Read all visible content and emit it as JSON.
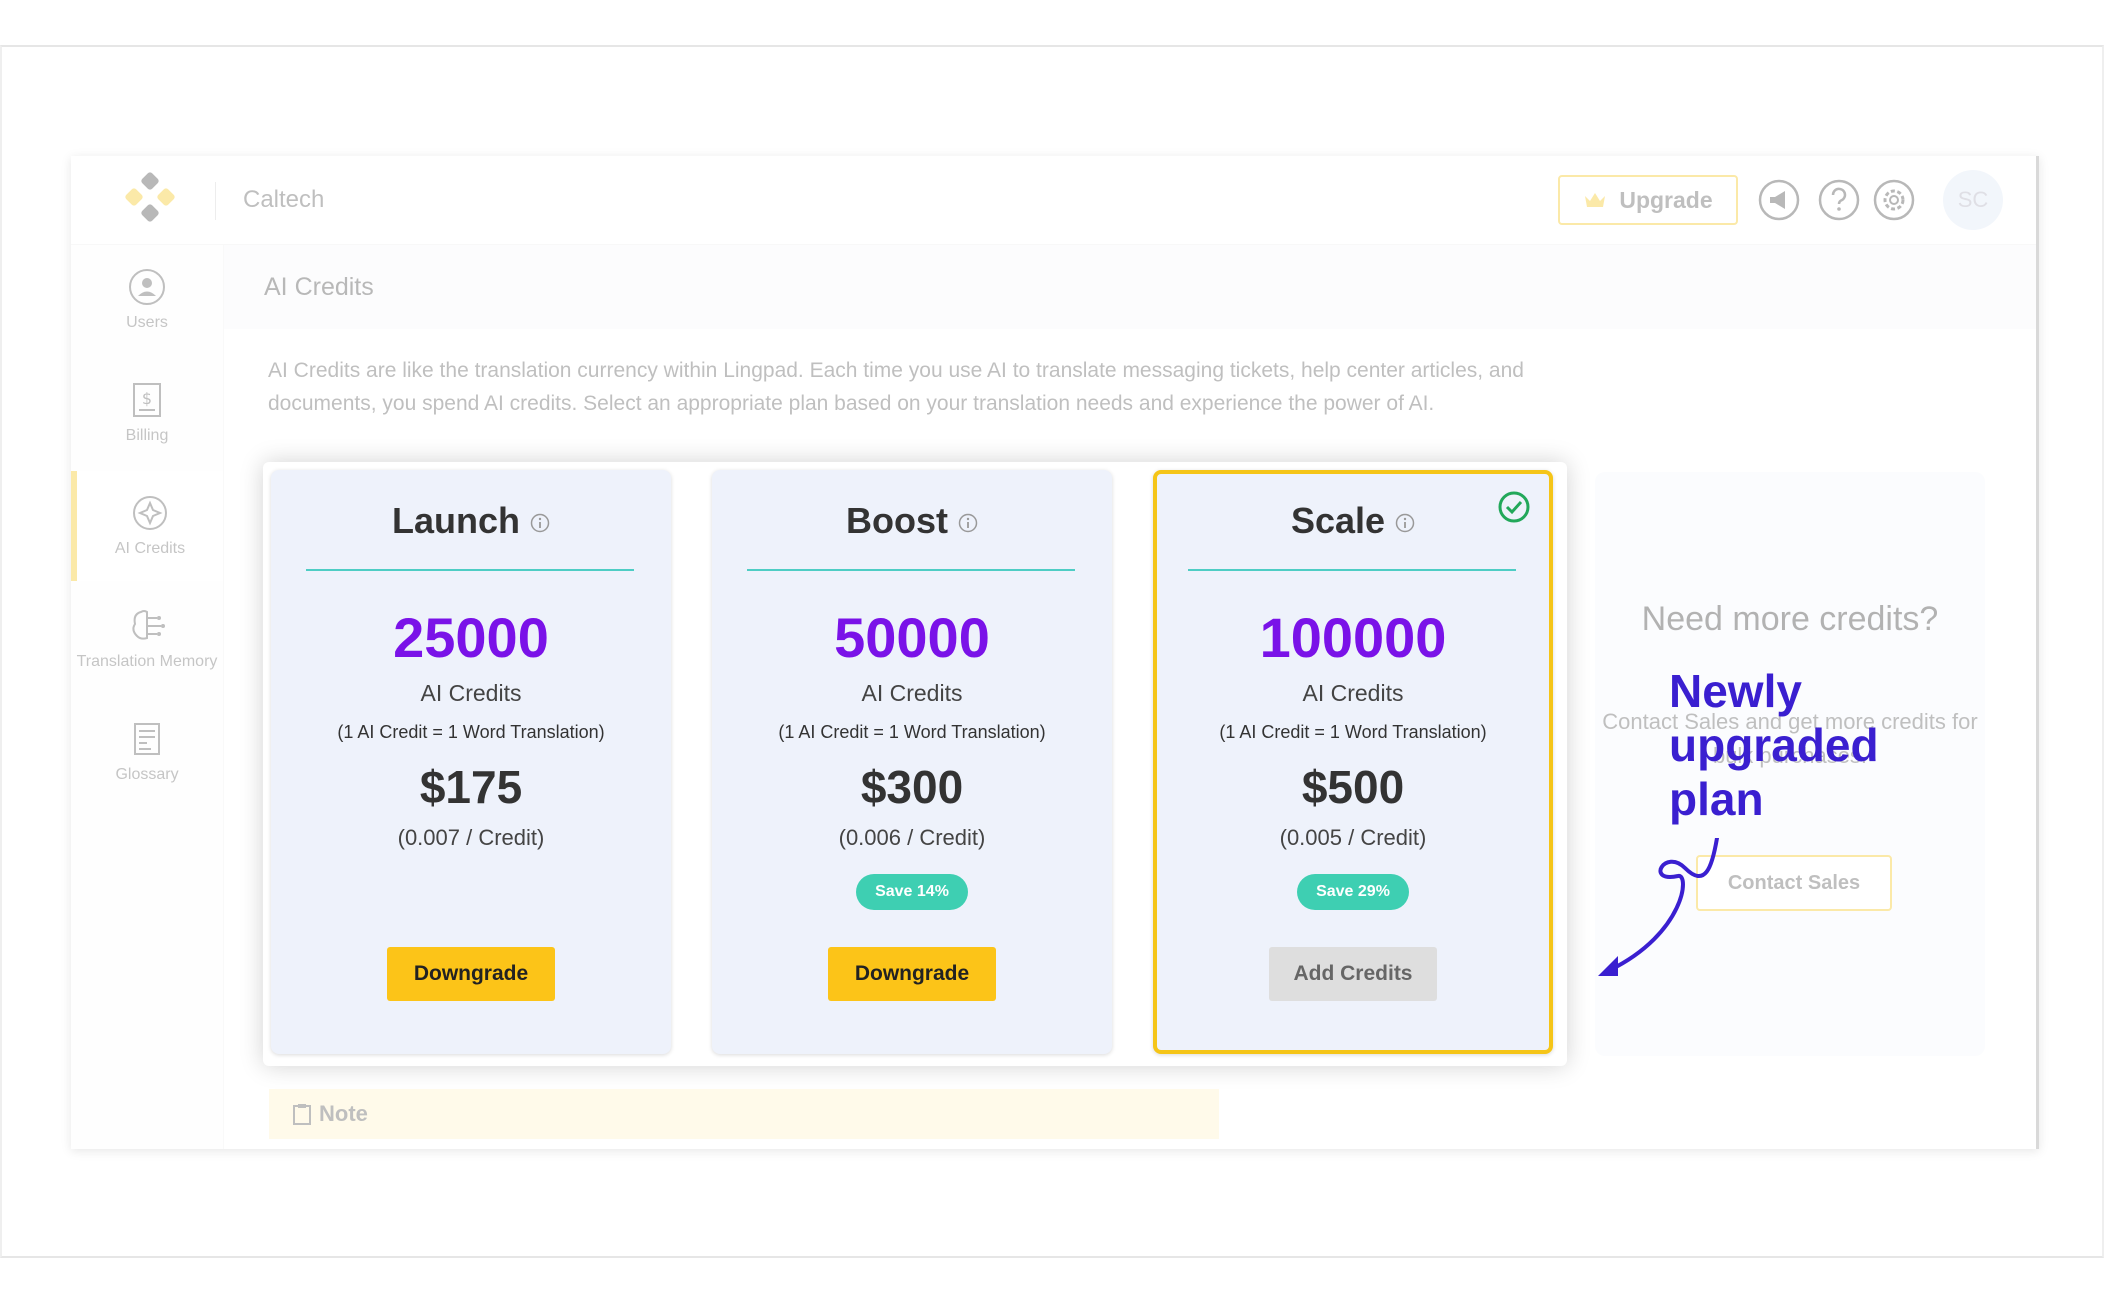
{
  "app": {
    "org_name": "Caltech",
    "upgrade_label": "Upgrade",
    "avatar_initials": "SC"
  },
  "sidebar": {
    "items": [
      {
        "label": "Users",
        "icon": "user-circle-icon"
      },
      {
        "label": "Billing",
        "icon": "billing-icon"
      },
      {
        "label": "AI Credits",
        "icon": "ai-credits-icon",
        "active": true
      },
      {
        "label": "Translation Memory",
        "icon": "translation-memory-icon"
      },
      {
        "label": "Glossary",
        "icon": "glossary-icon"
      }
    ]
  },
  "page": {
    "title": "AI Credits",
    "description": "AI Credits are like the translation currency within Lingpad. Each time you use AI to translate messaging tickets, help center articles, and documents, you spend AI credits. Select an appropriate plan based on your translation needs and experience the power of AI."
  },
  "plans": [
    {
      "name": "Launch",
      "credits": "25000",
      "unit": "AI Credits",
      "note": "(1 AI Credit = 1 Word Translation)",
      "price": "$175",
      "rate": "(0.007 / Credit)",
      "save": "",
      "button": "Downgrade",
      "current": false
    },
    {
      "name": "Boost",
      "credits": "50000",
      "unit": "AI Credits",
      "note": "(1 AI Credit = 1 Word Translation)",
      "price": "$300",
      "rate": "(0.006 / Credit)",
      "save": "Save 14%",
      "button": "Downgrade",
      "current": false
    },
    {
      "name": "Scale",
      "credits": "100000",
      "unit": "AI Credits",
      "note": "(1 AI Credit = 1 Word Translation)",
      "price": "$500",
      "rate": "(0.005 / Credit)",
      "save": "Save 29%",
      "button": "Add Credits",
      "current": true
    }
  ],
  "enterprise": {
    "title": "Need more credits?",
    "description": "Contact Sales and get more credits for bulk purchases.",
    "button": "Contact Sales"
  },
  "note": {
    "label": "Note"
  },
  "annotation": {
    "text": "Newly upgraded plan"
  },
  "colors": {
    "accent": "#fcc418",
    "credits_purple": "#7a12e8",
    "save_teal": "#3ecfb2",
    "divider_teal": "#4ecdc4",
    "annotation": "#3a1fd0"
  }
}
